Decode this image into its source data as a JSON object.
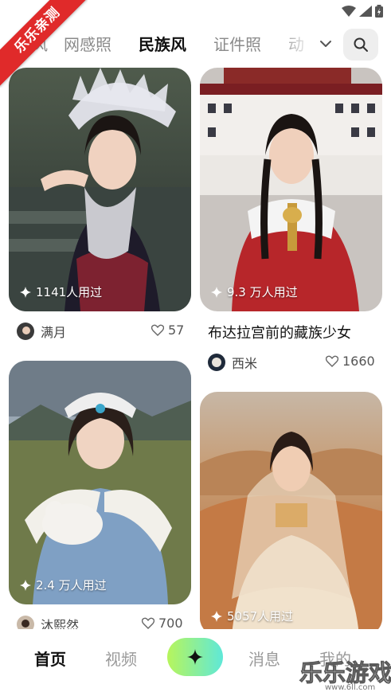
{
  "watermark": {
    "ribbon_text": "乐乐亲测",
    "site_name": "乐乐游戏",
    "site_url": "www.6ll.com"
  },
  "tabs": {
    "items": [
      {
        "label": "风",
        "active": false
      },
      {
        "label": "网感照",
        "active": false
      },
      {
        "label": "民族风",
        "active": true
      },
      {
        "label": "证件照",
        "active": false
      },
      {
        "label": "动",
        "active": false
      }
    ],
    "more_icon": "chevron-down-icon",
    "search_icon": "search-icon"
  },
  "feed": {
    "cards": [
      {
        "usage": "1141人用过",
        "author": "满月",
        "likes": "57",
        "title": ""
      },
      {
        "usage": "9.3 万人用过",
        "author": "西米",
        "likes": "1660",
        "title": "布达拉宫前的藏族少女"
      },
      {
        "usage": "2.4 万人用过",
        "author": "沐熙然",
        "likes": "700",
        "title": ""
      },
      {
        "usage": "5057人用过",
        "author": "",
        "likes": "",
        "title": ""
      }
    ]
  },
  "bottom_nav": {
    "items": [
      {
        "label": "首页",
        "active": true
      },
      {
        "label": "视频",
        "active": false
      },
      {
        "label": "消息",
        "active": false
      },
      {
        "label": "我的",
        "active": false
      }
    ],
    "create_icon": "sparkle-icon"
  },
  "colors": {
    "accent_green": "#b6f26b",
    "accent_cyan": "#5fe8d8",
    "ribbon_red": "#e02a2a"
  }
}
